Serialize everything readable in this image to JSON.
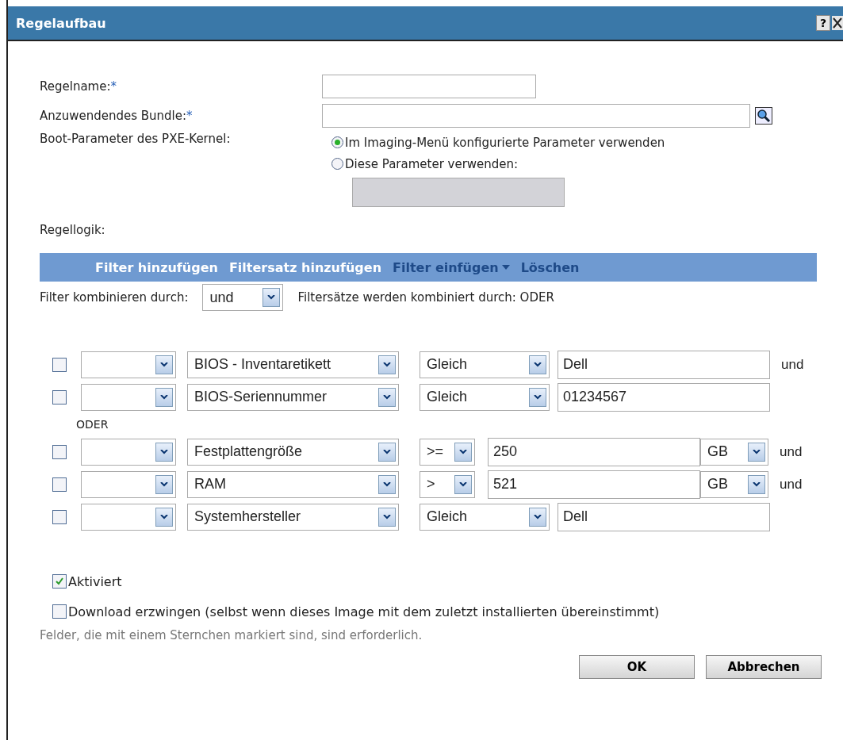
{
  "window": {
    "title": "Regelaufbau",
    "help": "?"
  },
  "fields": [
    {
      "label": "Regelname:",
      "required": "*",
      "kind": "short"
    },
    {
      "label": "Anzuwendendes Bundle:",
      "required": "*",
      "kind": "browse"
    }
  ],
  "boot": {
    "label": "Boot-Parameter des PXE-Kernel:",
    "options": [
      {
        "label": "Im Imaging-Menü konfigurierte Parameter verwenden",
        "selected": true
      },
      {
        "label": "Diese Parameter verwenden:",
        "selected": false
      }
    ],
    "params_disabled": true
  },
  "logic_label": "Regellogik:",
  "toolbar": [
    {
      "label": "Filter hinzufügen",
      "disabled": false,
      "caret": false
    },
    {
      "label": "Filtersatz hinzufügen",
      "disabled": false,
      "caret": false
    },
    {
      "label": "Filter einfügen",
      "disabled": true,
      "caret": true
    },
    {
      "label": "Löschen",
      "disabled": true,
      "caret": false
    }
  ],
  "combine": {
    "label": "Filter kombinieren durch:",
    "value": "und",
    "note": "Filtersätze werden kombiniert durch: ODER"
  },
  "filter_sets": [
    {
      "rows": [
        {
          "kind": "text",
          "checked": false,
          "attribute": "BIOS - Inventaretikett",
          "operator": "Gleich",
          "value": "Dell",
          "conjunction": "und"
        },
        {
          "kind": "text",
          "checked": false,
          "attribute": "BIOS-Seriennummer",
          "operator": "Gleich",
          "value": "01234567"
        }
      ]
    },
    {
      "separator": "ODER",
      "rows": [
        {
          "kind": "unit",
          "checked": false,
          "attribute": "Festplattengröße",
          "operator": ">=",
          "value": "250",
          "unit": "GB",
          "conjunction": "und"
        },
        {
          "kind": "unit",
          "checked": false,
          "attribute": "RAM",
          "operator": ">",
          "value": "521",
          "unit": "GB",
          "conjunction": "und"
        },
        {
          "kind": "text",
          "checked": false,
          "attribute": "Systemhersteller",
          "operator": "Gleich",
          "value": "Dell"
        }
      ]
    }
  ],
  "options": [
    {
      "label": "Aktiviert",
      "checked": true
    },
    {
      "label": "Download erzwingen (selbst wenn dieses Image mit dem zuletzt installierten übereinstimmt)",
      "checked": false
    }
  ],
  "footnote": "Felder, die mit einem Sternchen markiert sind, sind erforderlich.",
  "buttons": [
    "OK",
    "Abbrechen"
  ]
}
